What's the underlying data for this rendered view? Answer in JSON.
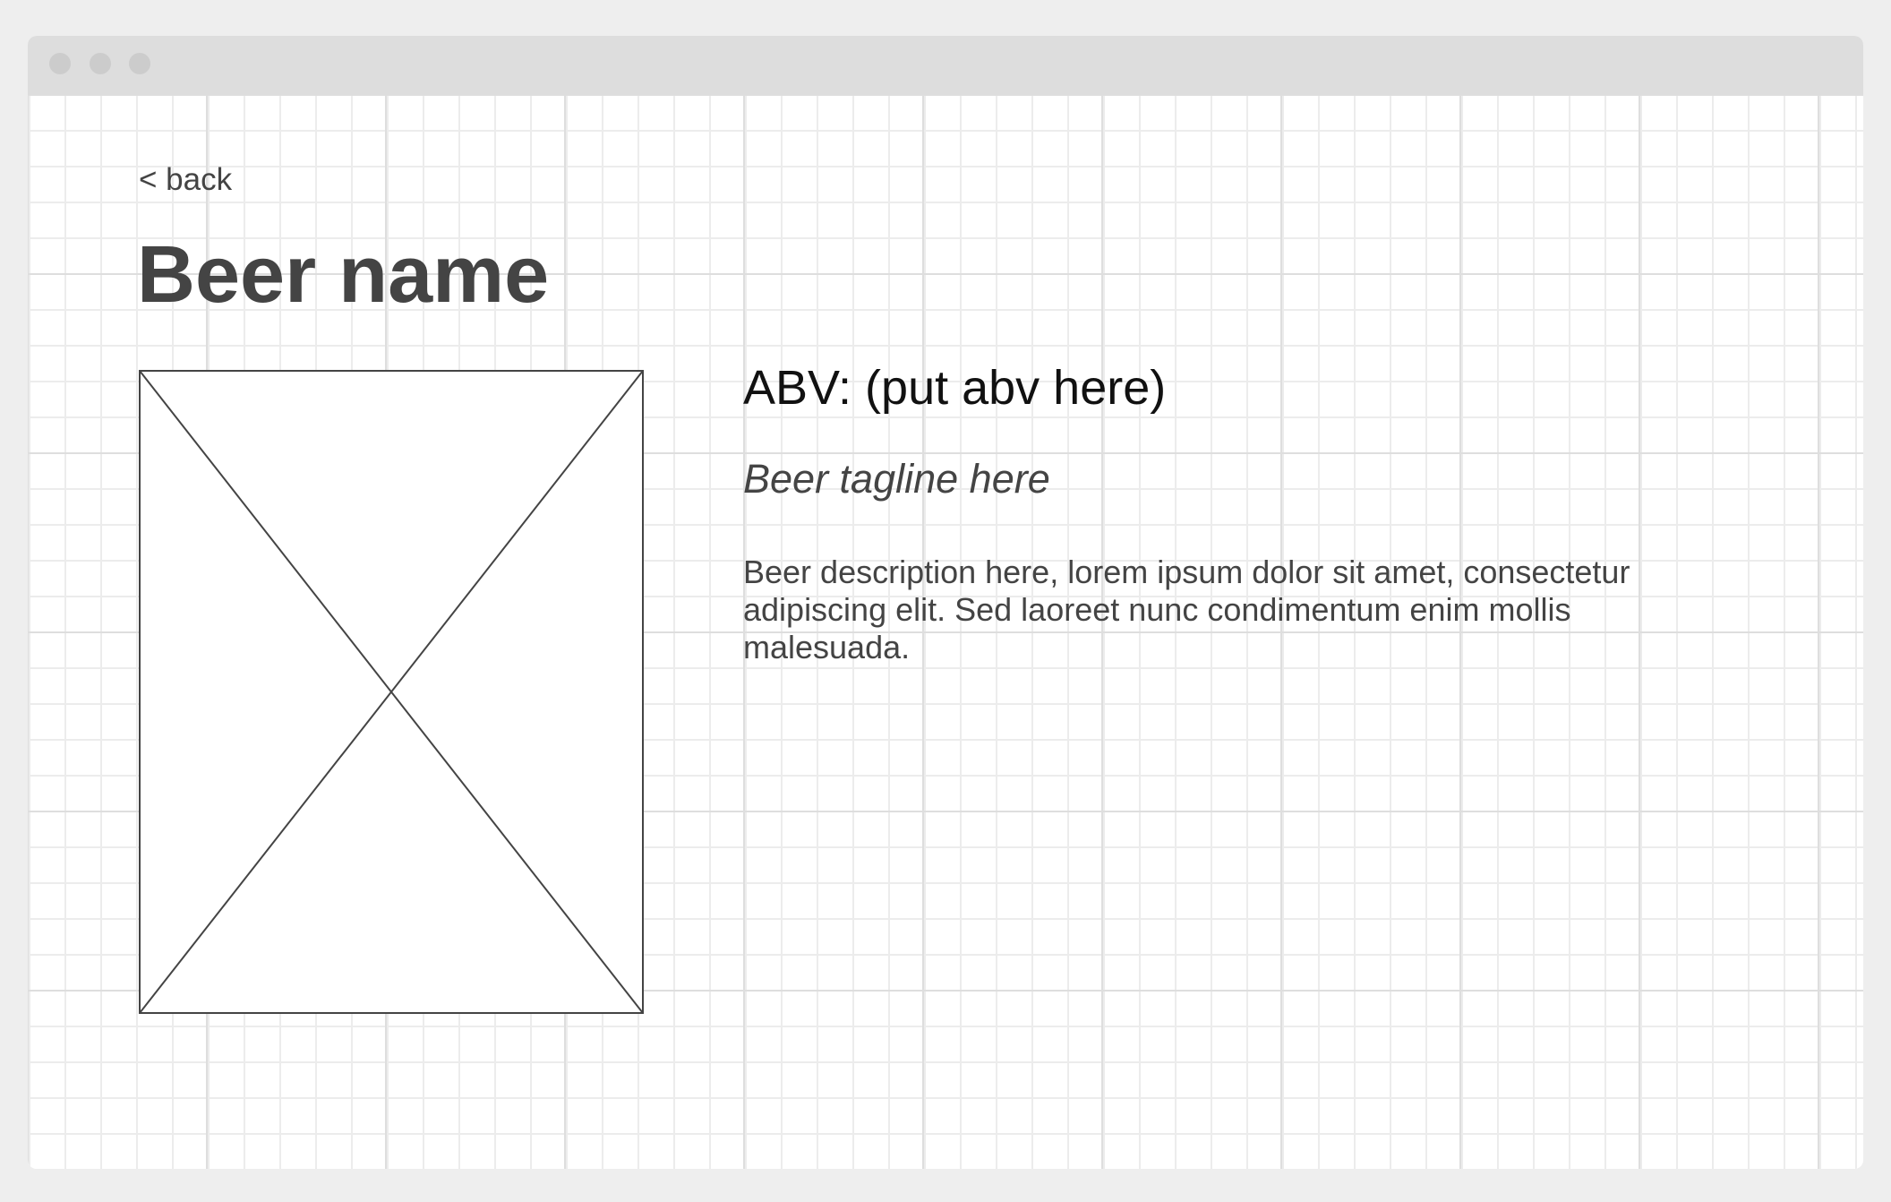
{
  "window": {
    "controls": [
      "close-dot",
      "minimize-dot",
      "maximize-dot"
    ]
  },
  "nav": {
    "back_label": "< back"
  },
  "beer": {
    "name": "Beer name",
    "abv": "ABV: (put abv here)",
    "tagline": "Beer tagline here",
    "description": "Beer description here, lorem ipsum dolor sit amet, consectetur adipiscing elit. Sed laoreet nunc condimentum enim mollis malesuada.",
    "image_icon": "image-placeholder-icon"
  }
}
